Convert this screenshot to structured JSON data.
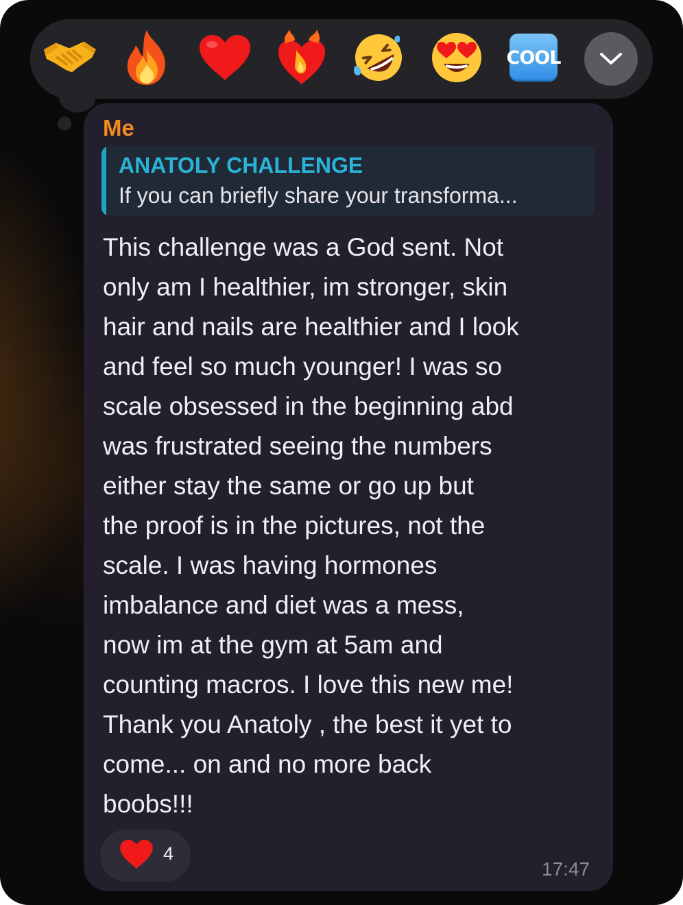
{
  "reaction_picker": {
    "reactions": [
      {
        "name": "handshake",
        "glyph": "🤝"
      },
      {
        "name": "fire",
        "glyph": "🔥"
      },
      {
        "name": "red-heart",
        "glyph": "❤️"
      },
      {
        "name": "heart-on-fire",
        "glyph": "❤️‍🔥"
      },
      {
        "name": "rolling-on-the-floor-laughing",
        "glyph": "🤣"
      },
      {
        "name": "smiling-face-with-heart-eyes",
        "glyph": "😍"
      },
      {
        "name": "cool-button",
        "label": "COOL"
      }
    ],
    "expand_icon": "chevron-down-icon"
  },
  "message": {
    "sender": "Me",
    "reply": {
      "title": "ANATOLY CHALLENGE",
      "preview": "If you can briefly share your transforma..."
    },
    "lines": [
      "This challenge was a God sent. Not",
      "only am I healthier, im stronger, skin",
      "hair and nails are healthier and I look",
      "and feel so much younger! I was so",
      "scale obsessed in the beginning abd",
      "was frustrated seeing the numbers",
      "either stay the same or go up but",
      "the proof is in the pictures, not the",
      "scale. I was having hormones",
      "imbalance and diet was a mess,",
      "now im at the gym at 5am and",
      "counting macros. I love this new me!",
      "Thank you Anatoly , the best it yet to",
      "come... on and no more back",
      "boobs!!!"
    ],
    "reaction_chip": {
      "icon": "heart-icon",
      "count": "4"
    },
    "time": "17:47"
  },
  "colors": {
    "sender": "#f28c1c",
    "reply_accent": "#1fa3c9",
    "bubble": "#231f2c",
    "picker": "#242327"
  }
}
